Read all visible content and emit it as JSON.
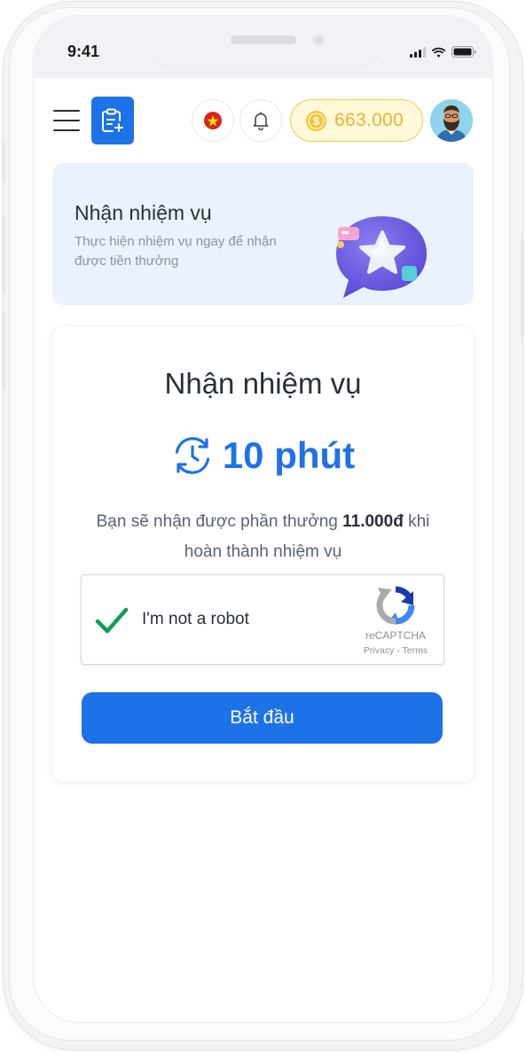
{
  "status_bar": {
    "time": "9:41",
    "icons": [
      "signal-icon",
      "wifi-icon",
      "battery-icon"
    ]
  },
  "header": {
    "menu_icon": "hamburger-menu-icon",
    "logo_icon": "clipboard-add-icon",
    "language_icon": "vietnam-flag-icon",
    "notification_icon": "bell-icon",
    "coin_icon": "dollar-coin-icon",
    "balance": "663.000",
    "avatar_icon": "user-avatar-icon"
  },
  "banner": {
    "title": "Nhận nhiệm vụ",
    "subtitle": "Thực hiện nhiệm vụ ngay để nhận được tiền thưởng",
    "illustration_icon": "star-chat-bubble-icon"
  },
  "task_card": {
    "title": "Nhận nhiệm vụ",
    "timer_icon": "clock-refresh-icon",
    "duration": "10 phút",
    "reward_prefix": "Bạn sẽ nhận được phần thưởng",
    "reward_amount": "11.000đ",
    "reward_suffix": "khi hoàn thành nhiệm vụ",
    "captcha": {
      "checked": true,
      "label": "I'm not a robot",
      "brand": "reCAPTCHA",
      "privacy_link": "Privacy",
      "separator": " - ",
      "terms_link": "Terms"
    },
    "start_button": "Bắt đầu"
  },
  "colors": {
    "primary": "#1e72e8",
    "coin_gold": "#e8b52b",
    "banner_bg": "#eaf2fd",
    "check_green": "#0f9d58"
  }
}
